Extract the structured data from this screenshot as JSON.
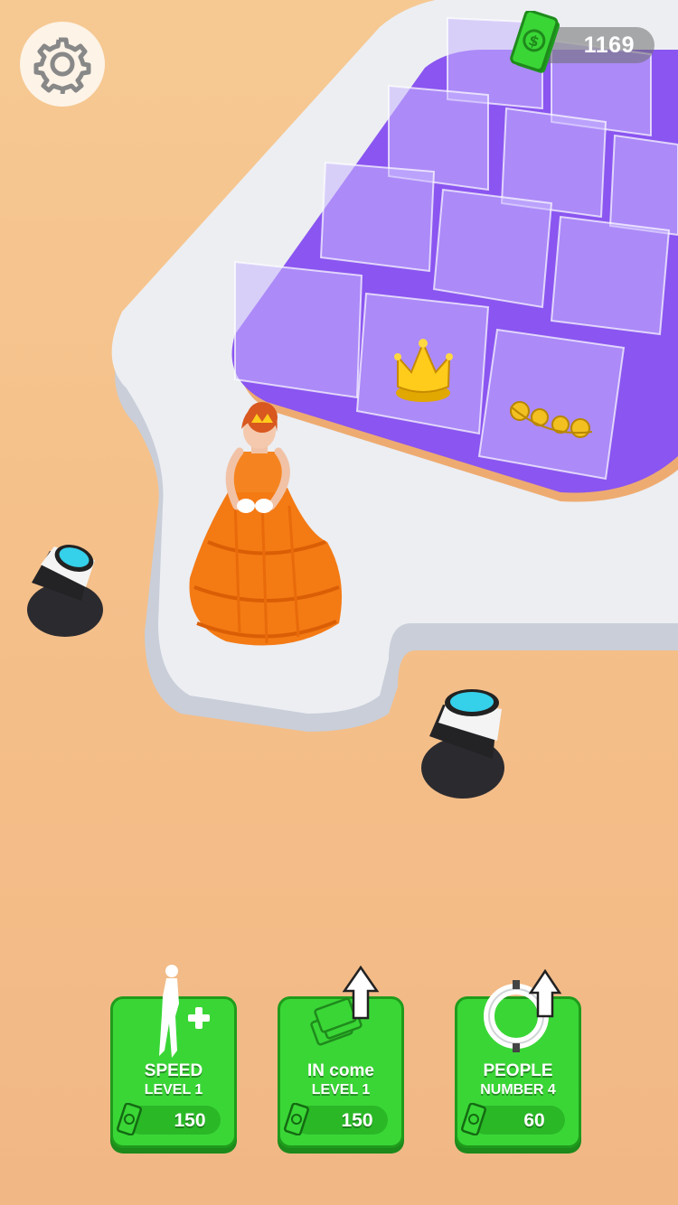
{
  "hud": {
    "money": "1169",
    "settings_icon": "gear-icon",
    "money_icon": "cash-icon"
  },
  "upgrades": [
    {
      "id": "speed",
      "title": "SPEED",
      "subtitle": "LEVEL 1",
      "price": "150",
      "icon": "walking-person-plus-icon"
    },
    {
      "id": "income",
      "title": "IN come",
      "subtitle": "LEVEL 1",
      "price": "150",
      "icon": "cash-stack-arrow-up-icon"
    },
    {
      "id": "people",
      "title": "PEOPLE",
      "subtitle": "NUMBER 4",
      "price": "60",
      "icon": "ring-arrow-up-icon"
    }
  ],
  "colors": {
    "button_green": "#3ad636",
    "button_border": "#1f9b1c",
    "floor": "#f5c08a",
    "display_purple": "#8a55f0",
    "gown_orange": "#f47a14"
  }
}
